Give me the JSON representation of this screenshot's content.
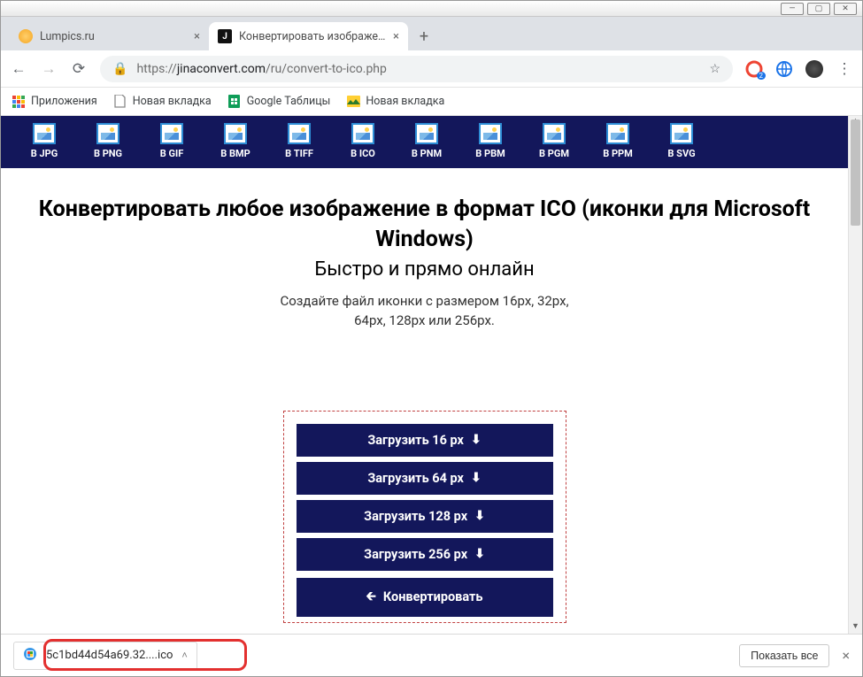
{
  "window": {
    "controls": [
      "min",
      "max",
      "close"
    ]
  },
  "tabs": [
    {
      "title": "Lumpics.ru",
      "active": false,
      "favicon_color": "#f5a623"
    },
    {
      "title": "Конвертировать изображения ",
      "active": true,
      "favicon_color": "#111",
      "favicon_letter": "J"
    }
  ],
  "address": {
    "scheme": "https://",
    "host": "jinaconvert.com",
    "path": "/ru/convert-to-ico.php"
  },
  "bookmarks": [
    {
      "label": "Приложения",
      "icon": "apps"
    },
    {
      "label": "Новая вкладка",
      "icon": "page"
    },
    {
      "label": "Google Таблицы",
      "icon": "sheets"
    },
    {
      "label": "Новая вкладка",
      "icon": "image"
    }
  ],
  "formats": [
    {
      "label": "В JPG"
    },
    {
      "label": "В PNG"
    },
    {
      "label": "В GIF"
    },
    {
      "label": "В BMP"
    },
    {
      "label": "В TIFF"
    },
    {
      "label": "В ICO"
    },
    {
      "label": "В PNM"
    },
    {
      "label": "В PBM"
    },
    {
      "label": "В PGM"
    },
    {
      "label": "В PPM"
    },
    {
      "label": "В SVG"
    }
  ],
  "headings": {
    "h1": "Конвертировать любое изображение в формат ICO (иконки для Microsoft Windows)",
    "h2": "Быстро и прямо онлайн",
    "sub1": "Создайте файл иконки с размером 16px, 32px,",
    "sub2": "64px, 128px или 256px."
  },
  "downloads": [
    {
      "label": "Загрузить 16 px"
    },
    {
      "label": "Загрузить 64 px"
    },
    {
      "label": "Загрузить 128 px"
    },
    {
      "label": "Загрузить 256 px"
    }
  ],
  "convert_label": "Конвертировать",
  "shelf": {
    "file": "5c1bd44d54a69.32....ico",
    "show_all": "Показать все"
  },
  "ext_badge": "2"
}
